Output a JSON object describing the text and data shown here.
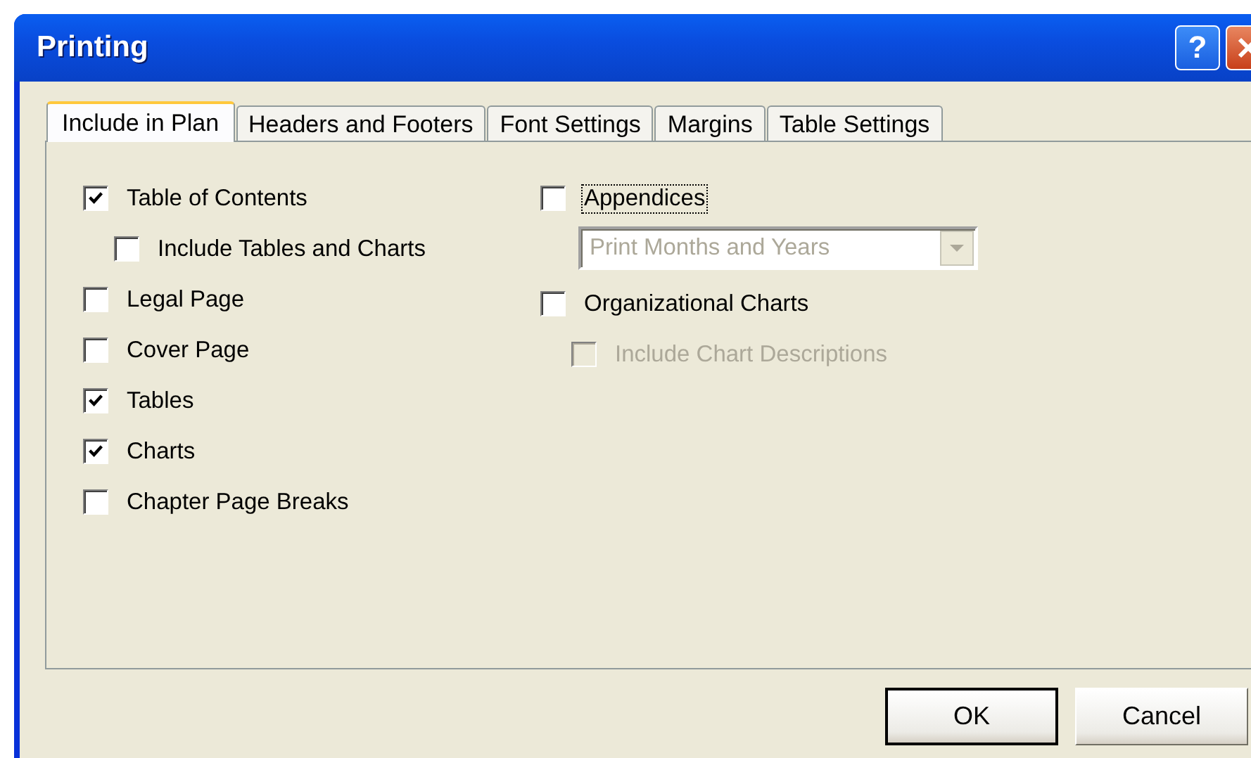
{
  "window": {
    "title": "Printing"
  },
  "title_buttons": [
    {
      "kind": "help",
      "label": "?"
    },
    {
      "kind": "close"
    }
  ],
  "tabs": [
    {
      "label": "Include in Plan",
      "selected": true
    },
    {
      "label": "Headers and Footers",
      "selected": false
    },
    {
      "label": "Font Settings",
      "selected": false
    },
    {
      "label": "Margins",
      "selected": false
    },
    {
      "label": "Table Settings",
      "selected": false
    }
  ],
  "columns": [
    {
      "items": [
        {
          "kind": "checkbox",
          "label": "Table of Contents",
          "checked": true,
          "disabled": false,
          "focused": false,
          "children": [
            {
              "label": "Include Tables and Charts",
              "checked": false,
              "disabled": false,
              "focused": false
            }
          ]
        },
        {
          "kind": "checkbox",
          "label": "Legal Page",
          "checked": false,
          "disabled": false,
          "focused": false
        },
        {
          "kind": "checkbox",
          "label": "Cover Page",
          "checked": false,
          "disabled": false,
          "focused": false
        },
        {
          "kind": "checkbox",
          "label": "Tables",
          "checked": true,
          "disabled": false,
          "focused": false
        },
        {
          "kind": "checkbox",
          "label": "Charts",
          "checked": true,
          "disabled": false,
          "focused": false
        },
        {
          "kind": "checkbox",
          "label": "Chapter Page Breaks",
          "checked": false,
          "disabled": false,
          "focused": false
        }
      ]
    },
    {
      "items": [
        {
          "kind": "checkbox",
          "label": "Appendices",
          "checked": false,
          "disabled": false,
          "focused": true
        },
        {
          "kind": "dropdown",
          "value": "Print Months and Years",
          "disabled": true
        },
        {
          "kind": "checkbox",
          "label": "Organizational Charts",
          "checked": false,
          "disabled": false,
          "focused": false,
          "children": [
            {
              "label": "Include Chart Descriptions",
              "checked": false,
              "disabled": true,
              "focused": false
            }
          ]
        }
      ]
    }
  ],
  "buttons": [
    {
      "label": "OK",
      "default": true
    },
    {
      "label": "Cancel",
      "default": false
    }
  ]
}
